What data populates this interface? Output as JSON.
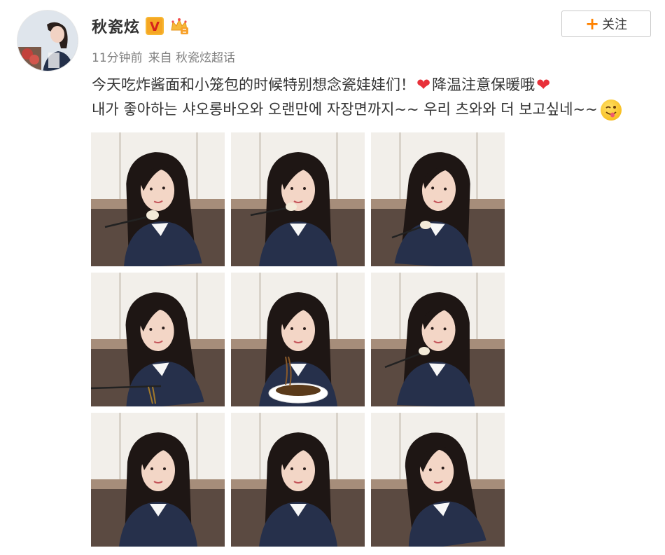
{
  "user": {
    "name": "秋瓷炫",
    "verified_badge": "V"
  },
  "follow_button": {
    "plus": "+",
    "label": "关注"
  },
  "meta": {
    "time": "11分钟前",
    "source": "来自 秋瓷炫超话"
  },
  "post": {
    "line1_part1": "今天吃炸酱面和小笼包的时候特别想念瓷娃娃们！",
    "line1_heart": "❤",
    "line1_part2": "降温注意保暖哦",
    "line1_heart2": "❤",
    "line2": "내가 좋아하는 샤오롱바오와 오랜만에 자장면까지~~ 우리 츠와와 더 보고싶네~~"
  },
  "photos": [
    {
      "icon": "photo-eating-dumpling"
    },
    {
      "icon": "photo-wink-dumpling"
    },
    {
      "icon": "photo-smile-dumpling"
    },
    {
      "icon": "photo-smile-chopsticks"
    },
    {
      "icon": "photo-eating-noodles"
    },
    {
      "icon": "photo-holding-dumpling"
    },
    {
      "icon": "photo-portrait-smile"
    },
    {
      "icon": "photo-portrait-calm"
    },
    {
      "icon": "photo-portrait-leaning"
    }
  ],
  "colors": {
    "accent_orange": "#ff8200",
    "heart_red": "#e8313a",
    "meta_gray": "#808080",
    "text": "#333333"
  }
}
